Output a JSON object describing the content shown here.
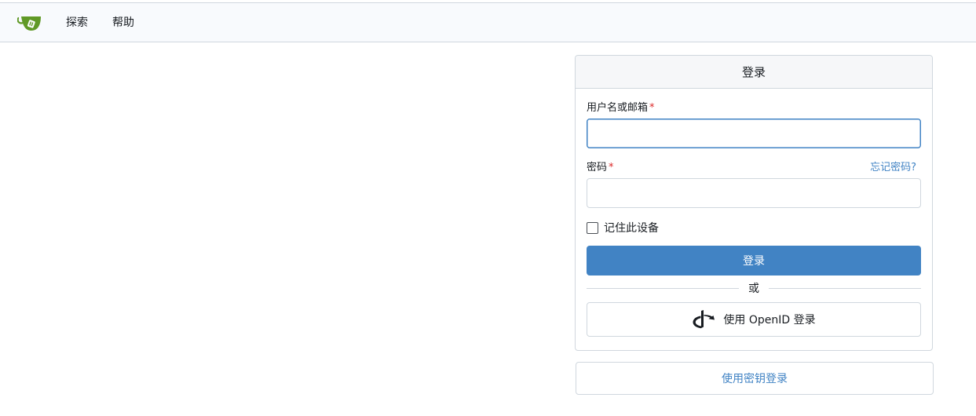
{
  "nav": {
    "logo_icon": "gitea-teacup-icon",
    "items": [
      {
        "label": "探索"
      },
      {
        "label": "帮助"
      }
    ]
  },
  "login": {
    "title": "登录",
    "username_label": "用户名或邮箱",
    "username_value": "",
    "password_label": "密码",
    "password_value": "",
    "required_mark": "*",
    "forgot_password": "忘记密码?",
    "remember_label": "记住此设备",
    "remember_checked": false,
    "submit_label": "登录",
    "divider_text": "或",
    "openid_label": "使用 OpenID 登录",
    "openid_icon": "openid-icon"
  },
  "passkey": {
    "label": "使用密钥登录"
  },
  "colors": {
    "accent": "#4183c4",
    "required": "#db2828",
    "logo_green": "#609926"
  }
}
